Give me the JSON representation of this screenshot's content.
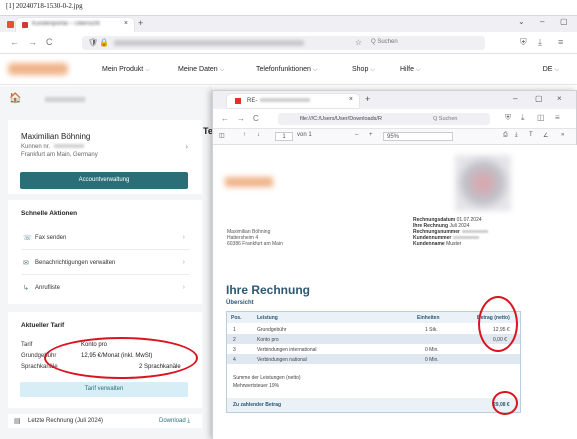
{
  "caption": "[1] 20240718-1530-0-2.jpg",
  "outer_browser": {
    "tab_title": "Kundenportal – Übersicht",
    "tab_close": "×",
    "new_tab": "+",
    "window_controls": [
      "⌄",
      "–",
      "▢"
    ],
    "nav_buttons": [
      "←",
      "→",
      "C"
    ],
    "url_icons": [
      "🛡",
      "🔒"
    ],
    "search_placeholder": "Q Suchen",
    "toolbar_icons": [
      "⛨",
      "⤓",
      "≡"
    ]
  },
  "site_menu": {
    "items": [
      "Mein Produkt",
      "Meine Daten",
      "Telefonfunktionen",
      "Shop",
      "Hilfe"
    ],
    "lang": "DE"
  },
  "left": {
    "home_icon": "🏠",
    "user_name": "Maximilian Böhning",
    "user_line1": "Kunnen nr.",
    "user_line2": "Frankfurt am Main, Germany",
    "account_button": "Accountverwaltung",
    "quick_title": "Schnelle Aktionen",
    "actions": [
      {
        "icon": "☏",
        "label": "Fax senden"
      },
      {
        "icon": "✉",
        "label": "Benachrichtigungen verwalten"
      },
      {
        "icon": "↳",
        "label": "Anrufliste"
      }
    ],
    "chev": "›",
    "tarif_title": "Aktueller Tarif",
    "tarif_rows": [
      {
        "label": "Tarif",
        "value": "Konto pro"
      },
      {
        "label": "Grundgebühr",
        "value": "12,95 €/Monat (inkl. MwSt)"
      },
      {
        "label": "Sprachkanäle",
        "value": "2 Sprachkanäle"
      }
    ],
    "tarif_button": "Tarif verwalten",
    "last_bill": "Letzte Rechnung (Juli 2024)",
    "download": "Download ⤓",
    "truncated_heading": "Te"
  },
  "inner_window": {
    "tab_title": "RE-",
    "tab_close": "×",
    "new_tab": "+",
    "window_controls": [
      "–",
      "▢",
      "×"
    ],
    "nav_buttons": [
      "←",
      "→",
      "C"
    ],
    "url": "file:///C:/Users/User/Downloads/R",
    "search_placeholder": "Q Suchen",
    "pdf_page_current": "1",
    "pdf_page_total": "von 1",
    "pdf_zoom": "95%",
    "pdf_zoom_ops": [
      "–",
      "+"
    ],
    "pdf_nav": [
      "↑",
      "↓"
    ],
    "pdf_tools": [
      "⎙",
      "⤓",
      "T",
      "∠",
      "»"
    ],
    "pdf_sidebar_icon": "◫"
  },
  "pdf": {
    "address_lines": [
      "Maximilian Böhning",
      "Hattersheim 4",
      "60386 Frankfurt am Main"
    ],
    "meta": [
      {
        "label": "Rechnungsdatum",
        "value": "01.07.2024"
      },
      {
        "label": "Ihre Rechnung",
        "value": "Juli 2024"
      },
      {
        "label": "Rechnungsnummer",
        "value": ""
      },
      {
        "label": "Kundennummer",
        "value": ""
      },
      {
        "label": "Kundenname",
        "value": "Muster"
      }
    ],
    "heading": "Ihre Rechnung",
    "subheading": "Übersicht",
    "table_headers": [
      "Pos.",
      "Leistung",
      "Einheiten",
      "Betrag (netto)"
    ],
    "rows": [
      {
        "pos": "1",
        "label": "Grundgebühr",
        "units": "1 Stk.",
        "amount": "12,95 €"
      },
      {
        "pos": "2",
        "label": "Konto pro",
        "units": "",
        "amount": "0,00 €"
      },
      {
        "pos": "3",
        "label": "Verbindungen international",
        "units": "0 Min.",
        "amount": ""
      },
      {
        "pos": "4",
        "label": "Verbindungen national",
        "units": "0 Min.",
        "amount": ""
      }
    ],
    "sum_lines": [
      "Summe der Leistungen (netto)",
      "Mehrwertsteuer 19%"
    ],
    "total_label": "Zu zahlender Betrag",
    "total_value": "29,08 €"
  },
  "annotation_color": "#d9141f"
}
